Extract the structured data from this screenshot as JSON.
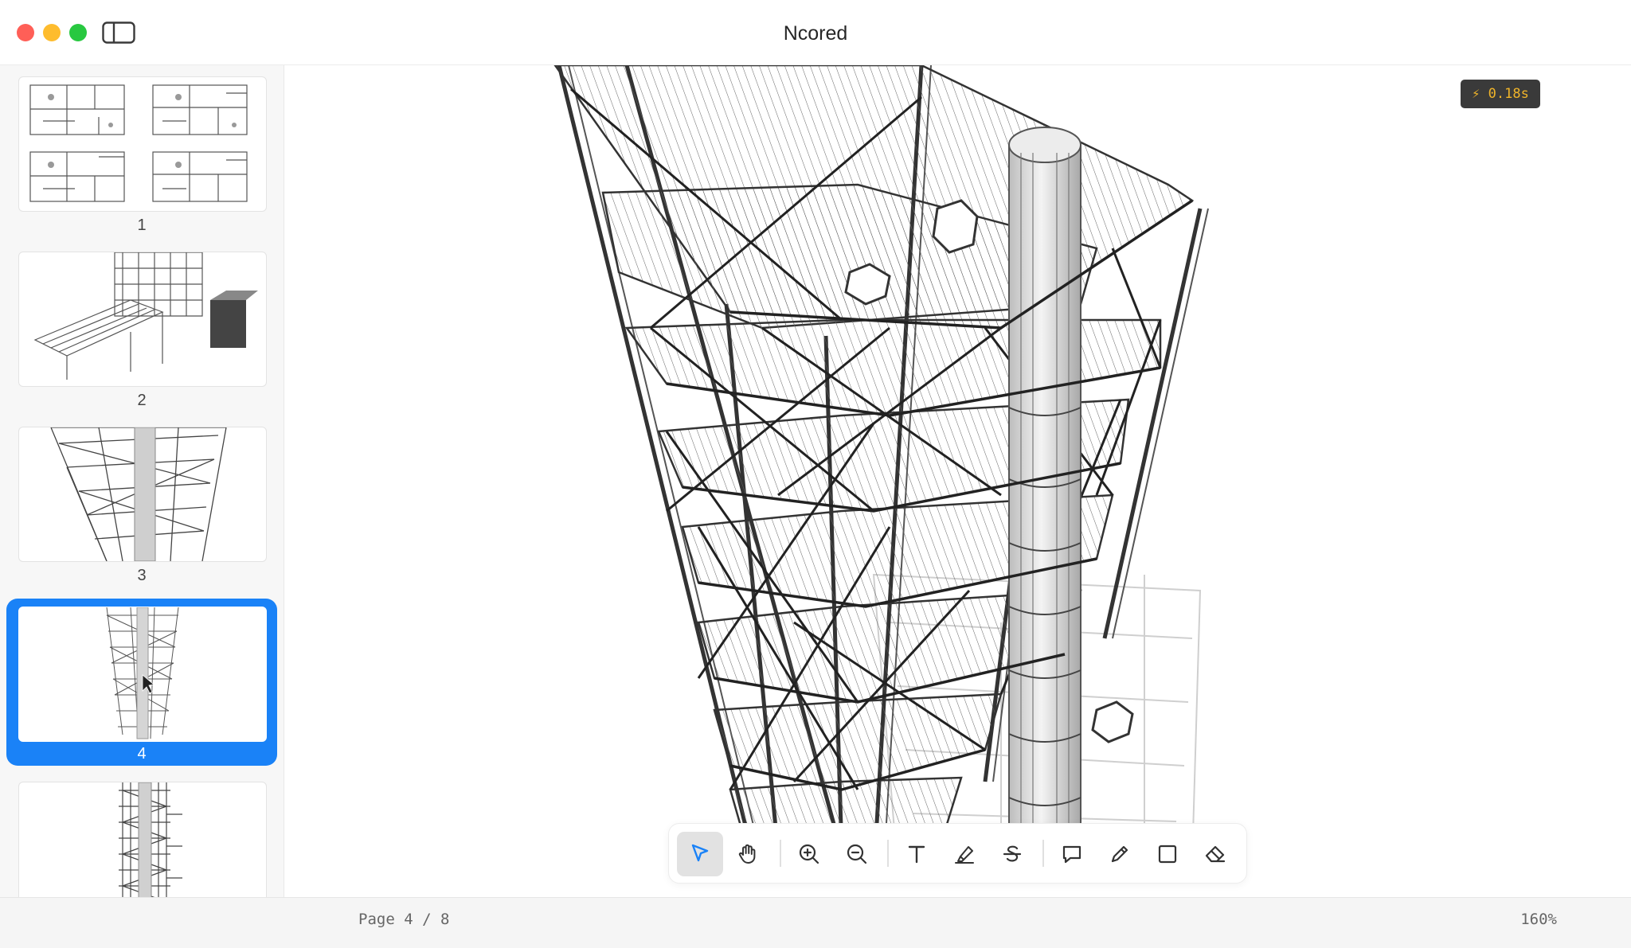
{
  "window": {
    "title": "Ncored"
  },
  "sidebar": {
    "pages": [
      {
        "label": "1",
        "selected": false,
        "content": "floor plans"
      },
      {
        "label": "2",
        "selected": false,
        "content": "isometric walkway drawing"
      },
      {
        "label": "3",
        "selected": false,
        "content": "tower structure drawing"
      },
      {
        "label": "4",
        "selected": true,
        "content": "tower structure drawing"
      },
      {
        "label": "",
        "selected": false,
        "content": "tower elevation drawing"
      }
    ]
  },
  "canvas": {
    "render_time": "⚡ 0.18s",
    "content": "isometric steel tower structure drawing"
  },
  "toolbar": {
    "tools": [
      {
        "name": "select",
        "icon": "cursor-arrow-icon",
        "active": true
      },
      {
        "name": "pan",
        "icon": "hand-icon",
        "active": false
      },
      {
        "name": "zoom-in",
        "icon": "zoom-in-icon",
        "active": false
      },
      {
        "name": "zoom-out",
        "icon": "zoom-out-icon",
        "active": false
      },
      {
        "name": "text",
        "icon": "text-icon",
        "active": false
      },
      {
        "name": "highlight",
        "icon": "highlighter-icon",
        "active": false
      },
      {
        "name": "strikethrough",
        "icon": "strikethrough-icon",
        "active": false
      },
      {
        "name": "comment",
        "icon": "speech-bubble-icon",
        "active": false
      },
      {
        "name": "draw",
        "icon": "pencil-icon",
        "active": false
      },
      {
        "name": "rectangle",
        "icon": "square-icon",
        "active": false
      },
      {
        "name": "eraser",
        "icon": "eraser-icon",
        "active": false
      }
    ],
    "accent_color": "#1a82f7"
  },
  "status": {
    "page_indicator": "Page 4 / 8",
    "zoom": "160%"
  },
  "colors": {
    "selection": "#1a82f7",
    "badge_bg": "#3a3a3a",
    "badge_text": "#f0b429"
  }
}
